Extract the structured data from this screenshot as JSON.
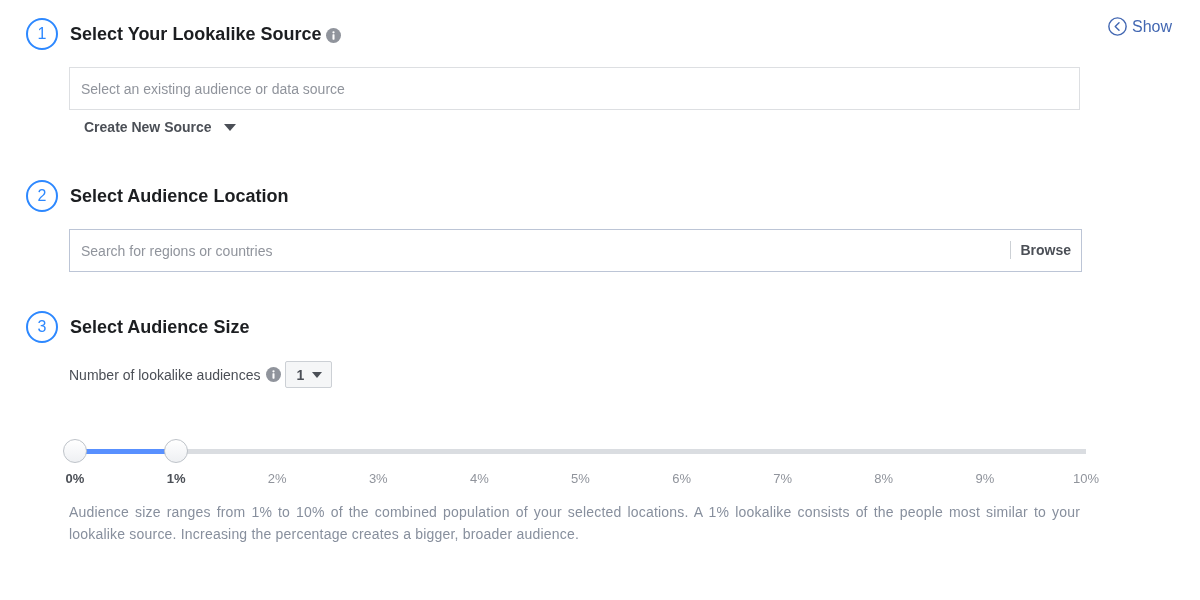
{
  "show_link": {
    "label": "Show"
  },
  "sections": [
    {
      "kind": "source",
      "number": "1",
      "title": "Select Your Lookalike Source",
      "info": true,
      "field": {
        "placeholder": "Select an existing audience or data source"
      },
      "menu_button": {
        "label": "Create New Source"
      }
    },
    {
      "kind": "location",
      "number": "2",
      "title": "Select Audience Location",
      "field": {
        "placeholder": "Search for regions or countries"
      },
      "browse_button": {
        "label": "Browse"
      }
    },
    {
      "kind": "size",
      "number": "3",
      "title": "Select Audience Size",
      "count": {
        "label": "Number of lookalike audiences",
        "info": true,
        "value": "1"
      },
      "slider": {
        "thumbs": [
          {
            "level": 0
          },
          {
            "level": 0.1
          }
        ],
        "ticks": [
          {
            "label": "0%",
            "active": true
          },
          {
            "label": "1%",
            "active": true
          },
          {
            "label": "2%",
            "active": false
          },
          {
            "label": "3%",
            "active": false
          },
          {
            "label": "4%",
            "active": false
          },
          {
            "label": "5%",
            "active": false
          },
          {
            "label": "6%",
            "active": false
          },
          {
            "label": "7%",
            "active": false
          },
          {
            "label": "8%",
            "active": false
          },
          {
            "label": "9%",
            "active": false
          },
          {
            "label": "10%",
            "active": false
          }
        ]
      },
      "description": "Audience size ranges from 1% to 10% of the combined population of your selected locations. A 1% lookalike consists of the people most similar to your lookalike source. Increasing the percentage creates a bigger, broader audience."
    }
  ]
}
